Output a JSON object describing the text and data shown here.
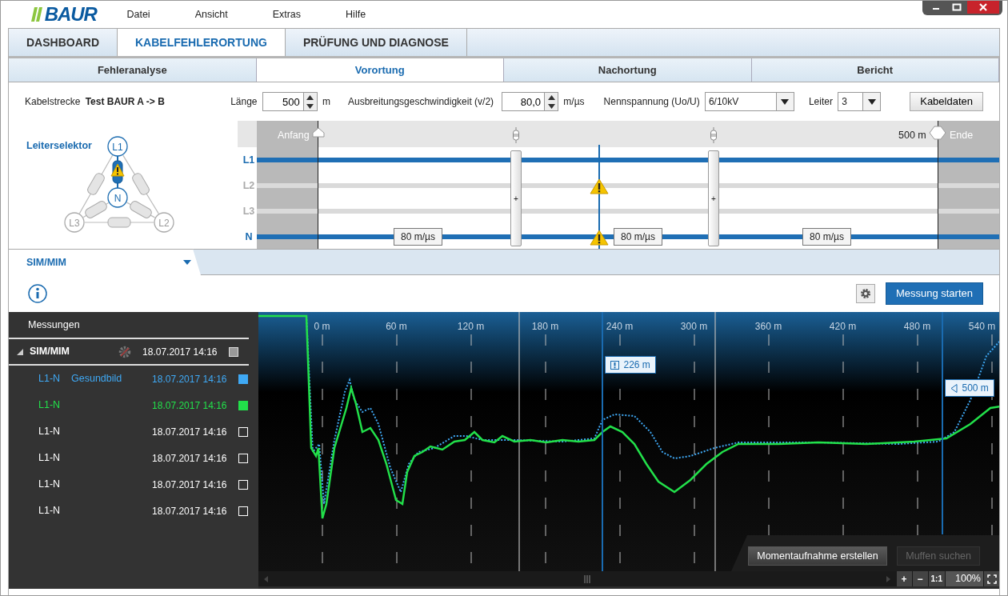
{
  "app": {
    "logo": "BAUR",
    "menu": [
      "Datei",
      "Ansicht",
      "Extras",
      "Hilfe"
    ]
  },
  "main_tabs": [
    {
      "label": "DASHBOARD",
      "selected": false
    },
    {
      "label": "KABELFEHLERORTUNG",
      "selected": true
    },
    {
      "label": "PRÜFUNG UND DIAGNOSE",
      "selected": false
    }
  ],
  "steps": [
    {
      "label": "Fehleranalyse",
      "selected": false
    },
    {
      "label": "Vorortung",
      "selected": true
    },
    {
      "label": "Nachortung",
      "selected": false
    },
    {
      "label": "Bericht",
      "selected": false
    }
  ],
  "cable": {
    "route_label": "Kabelstrecke",
    "route": "Test BAUR A -> B",
    "length_label": "Länge",
    "length": "500",
    "length_unit": "m",
    "speed_label": "Ausbreitungsgeschwindigkeit (v/2)",
    "speed": "80,0",
    "speed_unit": "m/µs",
    "voltage_label": "Nennspannung (Uo/U)",
    "voltage": "6/10kV",
    "conductors_label": "Leiter",
    "conductors": "3",
    "data_button": "Kabeldaten"
  },
  "selector": {
    "title": "Leiterselektor",
    "nodes": [
      {
        "label": "L1",
        "selected": true
      },
      {
        "label": "N",
        "selected": true
      },
      {
        "label": "L3",
        "selected": false
      },
      {
        "label": "L2",
        "selected": false
      }
    ]
  },
  "diagram": {
    "start_label": "Anfang",
    "end_distance": "500 m",
    "end_label": "Ende",
    "lines": [
      {
        "label": "L1",
        "active": true
      },
      {
        "label": "L2",
        "active": false
      },
      {
        "label": "L3",
        "active": false
      },
      {
        "label": "N",
        "active": true
      }
    ],
    "joints": [
      "+",
      "+"
    ],
    "speeds": [
      "80 m/µs",
      "80 m/µs",
      "80 m/µs"
    ]
  },
  "method_tab": {
    "label": "SIM/MIM"
  },
  "toolbar": {
    "start_button": "Messung starten"
  },
  "measurements": {
    "header": "Messungen",
    "group": {
      "label": "SIM/MIM",
      "expanded": true,
      "date": "18.07.2017 14:16",
      "checked": true
    },
    "rows": [
      {
        "phase": "L1-N",
        "note": "Gesundbild",
        "date": "18.07.2017 14:16",
        "color": "#3fa9f5",
        "checked": true
      },
      {
        "phase": "L1-N",
        "date": "18.07.2017 14:16",
        "color": "#22e04a",
        "checked": true
      },
      {
        "phase": "L1-N",
        "date": "18.07.2017 14:16",
        "color": "#ffffff",
        "checked": false
      },
      {
        "phase": "L1-N",
        "date": "18.07.2017 14:16",
        "color": "#ffffff",
        "checked": false
      },
      {
        "phase": "L1-N",
        "date": "18.07.2017 14:16",
        "color": "#ffffff",
        "checked": false
      },
      {
        "phase": "L1-N",
        "date": "18.07.2017 14:16",
        "color": "#ffffff",
        "checked": false
      }
    ]
  },
  "trace_plot": {
    "axis_labels": [
      "0 m",
      "60 m",
      "120 m",
      "180 m",
      "240 m",
      "300 m",
      "360 m",
      "420 m",
      "480 m",
      "540 m"
    ],
    "cursors": [
      {
        "kind": "fault",
        "label": "226 m"
      },
      {
        "kind": "end",
        "label": "500 m"
      }
    ],
    "snapshot_button": "Momentaufnahme erstellen",
    "joints_button": {
      "label": "Muffen suchen",
      "disabled": true
    },
    "zoom": {
      "zoom_in": "+",
      "zoom_out": "−",
      "reset": "1:1",
      "level_text": "100%"
    }
  }
}
